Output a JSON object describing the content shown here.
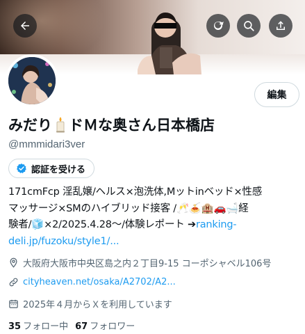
{
  "header": {
    "back_icon": "arrow-left-icon",
    "refresh_icon": "refresh-icon",
    "search_icon": "search-icon",
    "share_icon": "share-icon"
  },
  "profile": {
    "edit_label": "編集",
    "name_prefix": "みだり",
    "name_suffix": "ドＭな奥さん日本橋店",
    "handle": "@mmmidari3ver",
    "verify_label": "認証を受ける",
    "bio_lines": [
      "171cmFcp 淫乱嬢/ヘルス×泡洗体,Mットinベッド×性感",
      "マッサージ×SMのハイブリッド接客 /🥂🍝🏨🚗🛁経",
      "験者/🧊×2/2025.4.28～/体験レポート ➔"
    ],
    "bio_link_part1": "ranking-",
    "bio_link_part2": "deli.jp/fuzoku/style1/...",
    "location": "大阪府大阪市中央区島之内２丁目9-15 コーポシャベル106号",
    "website": "cityheaven.net/osaka/A2702/A2...",
    "joined": "2025年４月からＸを利用しています",
    "following_count": "35",
    "following_label": "フォロー中",
    "followers_count": "67",
    "followers_label": "フォロワー"
  },
  "colors": {
    "link": "#1d9bf0",
    "secondary_text": "#536471",
    "verified_badge": "#1d9bf0"
  }
}
